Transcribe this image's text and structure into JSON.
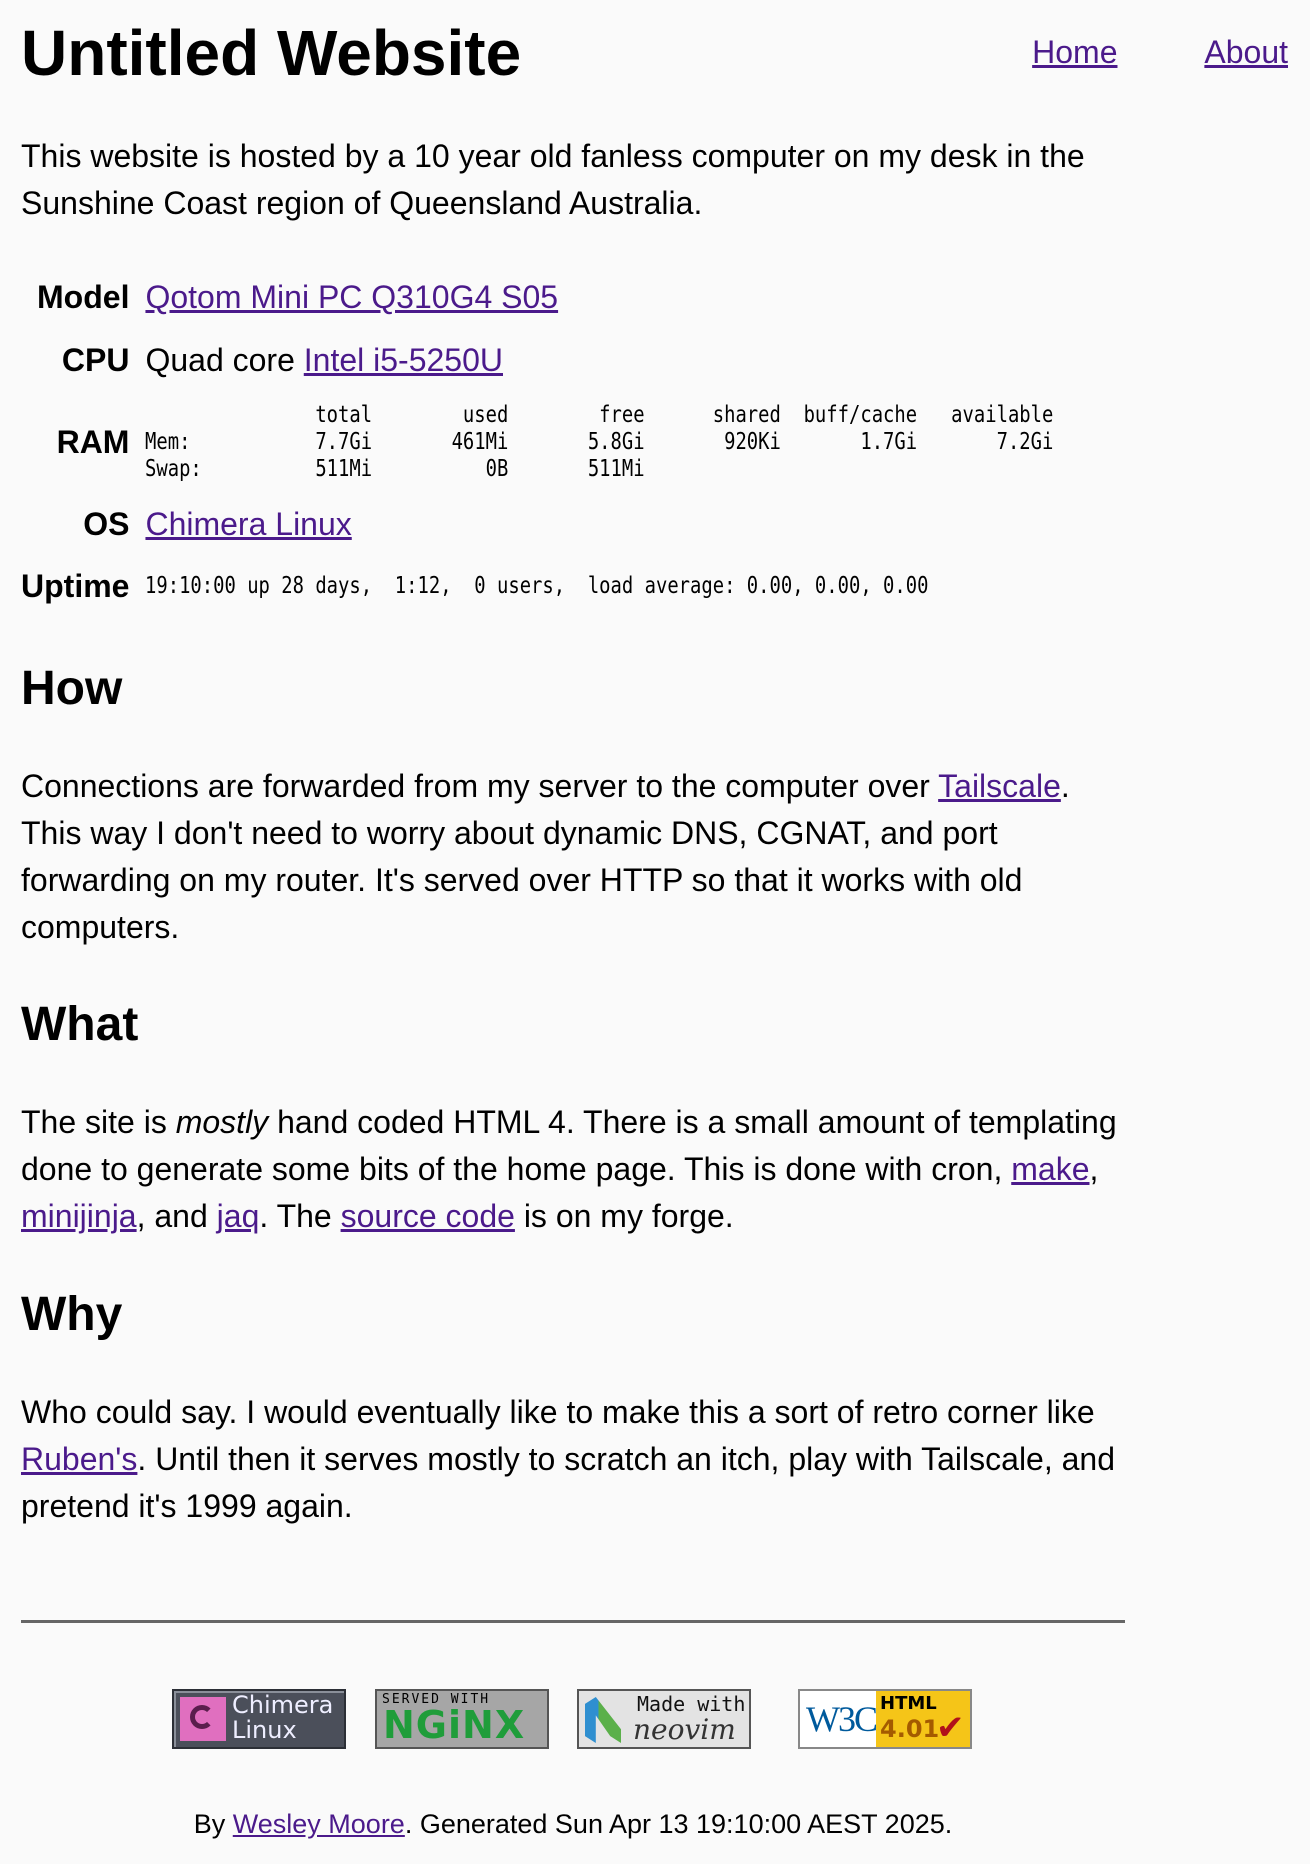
{
  "header": {
    "title": "Untitled Website",
    "nav": [
      {
        "label": "Home"
      },
      {
        "label": "About"
      }
    ]
  },
  "intro": "This website is hosted by a 10 year old fanless computer on my desk in the Sunshine Coast region of Queensland Australia.",
  "specs": {
    "model": {
      "label": "Model",
      "link": "Qotom Mini PC Q310G4 S05"
    },
    "cpu": {
      "label": "CPU",
      "prefix": "Quad core ",
      "link": "Intel i5-5250U"
    },
    "ram": {
      "label": "RAM",
      "output": "               total        used        free      shared  buff/cache   available\nMem:           7.7Gi       461Mi       5.8Gi       920Ki       1.7Gi       7.2Gi\nSwap:          511Mi          0B       511Mi"
    },
    "os": {
      "label": "OS",
      "link": "Chimera Linux"
    },
    "uptime": {
      "label": "Uptime",
      "output": "19:10:00 up 28 days,  1:12,  0 users,  load average: 0.00, 0.00, 0.00"
    }
  },
  "sections": {
    "how": {
      "heading": "How",
      "text1": "Connections are forwarded from my server to the computer over ",
      "link1": "Tailscale",
      "text2": ". This way I don't need to worry about dynamic DNS, CGNAT, and port forwarding on my router. It's served over HTTP so that it works with old computers."
    },
    "what": {
      "heading": "What",
      "text1": "The site is ",
      "em": "mostly",
      "text2": " hand coded HTML 4. There is a small amount of templating done to generate some bits of the home page. This is done with cron, ",
      "link_make": "make",
      "text3": ", ",
      "link_minijinja": "minijinja",
      "text4": ", and ",
      "link_jaq": "jaq",
      "text5": ". The ",
      "link_source": "source code",
      "text6": " is on my forge."
    },
    "why": {
      "heading": "Why",
      "text1": "Who could say. I would eventually like to make this a sort of retro corner like ",
      "link1": "Ruben's",
      "text2": ". Until then it serves mostly to scratch an itch, play with Tailscale, and pretend it's 1999 again."
    }
  },
  "badges": {
    "chimera": {
      "line1": "Chimera",
      "line2": "Linux",
      "icon": "chimera-logo-icon",
      "colors": {
        "bg": "#4b4f5a",
        "logo": "#e06fbf"
      }
    },
    "nginx": {
      "small": "SERVED WITH",
      "big": "NGiNX",
      "colors": {
        "bg": "#a6a6a6",
        "text": "#1f9d3a"
      }
    },
    "neovim": {
      "made": "Made with",
      "name": "neovim",
      "icon": "neovim-logo-icon"
    },
    "w3c": {
      "w3c": "W3C",
      "html": "HTML",
      "version": "4.01",
      "icon": "checkmark-icon",
      "colors": {
        "box": "#f5c518",
        "check": "#b0101a"
      }
    }
  },
  "footer": {
    "prefix": "By ",
    "author": "Wesley Moore",
    "suffix": ". Generated Sun Apr 13 19:10:00 AEST 2025."
  },
  "colors": {
    "background": "#fafafa",
    "link": "#4b1a8b",
    "rule": "#666666"
  }
}
